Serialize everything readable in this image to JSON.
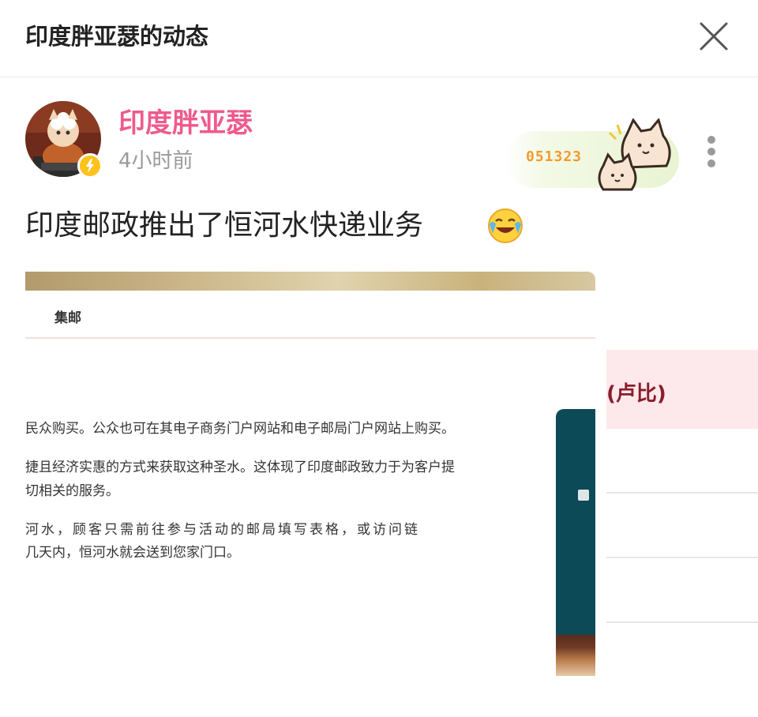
{
  "header": {
    "title": "印度胖亚瑟的动态"
  },
  "post": {
    "author": "印度胖亚瑟",
    "time": "4小时前",
    "decoration_code": "051323",
    "text": "印度邮政推出了恒河水快递业务"
  },
  "screenshot": {
    "tab_label": "集邮",
    "lines": [
      "民众购买。公众也可在其电子商务门户网站和电子邮局门户网站上购买。",
      "捷且经济实惠的方式来获取这种圣水。这体现了印度邮政致力于为客户提",
      "切相关的服务。",
      "河水，顾客只需前往参与活动的邮局填写表格，或访问链",
      "几天内，恒河水就会送到您家门口。"
    ],
    "side_text": "(卢比)"
  },
  "colors": {
    "author": "#ef5a8c",
    "time": "#9a9a9a",
    "title": "#222222",
    "decoration_code": "#f39a2e",
    "side_panel": "#0d4a57",
    "pink_band": "#fde9ec"
  },
  "icons": {
    "close": "close-icon",
    "more": "more-vertical-icon",
    "emoji": "laughing-crying-emoji",
    "vip": "lightning-icon"
  }
}
